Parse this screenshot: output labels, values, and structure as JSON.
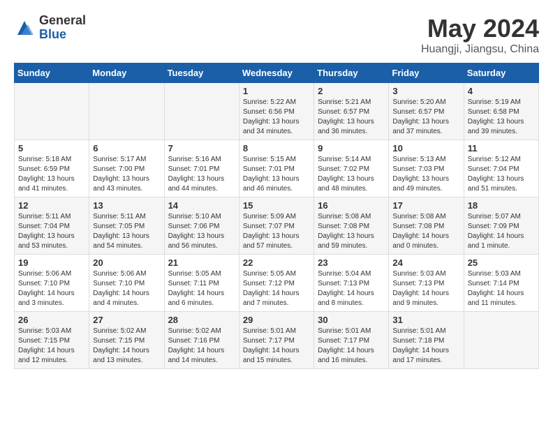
{
  "header": {
    "logo_general": "General",
    "logo_blue": "Blue",
    "title": "May 2024",
    "subtitle": "Huangji, Jiangsu, China"
  },
  "days_of_week": [
    "Sunday",
    "Monday",
    "Tuesday",
    "Wednesday",
    "Thursday",
    "Friday",
    "Saturday"
  ],
  "weeks": [
    [
      {
        "day": "",
        "info": ""
      },
      {
        "day": "",
        "info": ""
      },
      {
        "day": "",
        "info": ""
      },
      {
        "day": "1",
        "info": "Sunrise: 5:22 AM\nSunset: 6:56 PM\nDaylight: 13 hours and 34 minutes."
      },
      {
        "day": "2",
        "info": "Sunrise: 5:21 AM\nSunset: 6:57 PM\nDaylight: 13 hours and 36 minutes."
      },
      {
        "day": "3",
        "info": "Sunrise: 5:20 AM\nSunset: 6:57 PM\nDaylight: 13 hours and 37 minutes."
      },
      {
        "day": "4",
        "info": "Sunrise: 5:19 AM\nSunset: 6:58 PM\nDaylight: 13 hours and 39 minutes."
      }
    ],
    [
      {
        "day": "5",
        "info": "Sunrise: 5:18 AM\nSunset: 6:59 PM\nDaylight: 13 hours and 41 minutes."
      },
      {
        "day": "6",
        "info": "Sunrise: 5:17 AM\nSunset: 7:00 PM\nDaylight: 13 hours and 43 minutes."
      },
      {
        "day": "7",
        "info": "Sunrise: 5:16 AM\nSunset: 7:01 PM\nDaylight: 13 hours and 44 minutes."
      },
      {
        "day": "8",
        "info": "Sunrise: 5:15 AM\nSunset: 7:01 PM\nDaylight: 13 hours and 46 minutes."
      },
      {
        "day": "9",
        "info": "Sunrise: 5:14 AM\nSunset: 7:02 PM\nDaylight: 13 hours and 48 minutes."
      },
      {
        "day": "10",
        "info": "Sunrise: 5:13 AM\nSunset: 7:03 PM\nDaylight: 13 hours and 49 minutes."
      },
      {
        "day": "11",
        "info": "Sunrise: 5:12 AM\nSunset: 7:04 PM\nDaylight: 13 hours and 51 minutes."
      }
    ],
    [
      {
        "day": "12",
        "info": "Sunrise: 5:11 AM\nSunset: 7:04 PM\nDaylight: 13 hours and 53 minutes."
      },
      {
        "day": "13",
        "info": "Sunrise: 5:11 AM\nSunset: 7:05 PM\nDaylight: 13 hours and 54 minutes."
      },
      {
        "day": "14",
        "info": "Sunrise: 5:10 AM\nSunset: 7:06 PM\nDaylight: 13 hours and 56 minutes."
      },
      {
        "day": "15",
        "info": "Sunrise: 5:09 AM\nSunset: 7:07 PM\nDaylight: 13 hours and 57 minutes."
      },
      {
        "day": "16",
        "info": "Sunrise: 5:08 AM\nSunset: 7:08 PM\nDaylight: 13 hours and 59 minutes."
      },
      {
        "day": "17",
        "info": "Sunrise: 5:08 AM\nSunset: 7:08 PM\nDaylight: 14 hours and 0 minutes."
      },
      {
        "day": "18",
        "info": "Sunrise: 5:07 AM\nSunset: 7:09 PM\nDaylight: 14 hours and 1 minute."
      }
    ],
    [
      {
        "day": "19",
        "info": "Sunrise: 5:06 AM\nSunset: 7:10 PM\nDaylight: 14 hours and 3 minutes."
      },
      {
        "day": "20",
        "info": "Sunrise: 5:06 AM\nSunset: 7:10 PM\nDaylight: 14 hours and 4 minutes."
      },
      {
        "day": "21",
        "info": "Sunrise: 5:05 AM\nSunset: 7:11 PM\nDaylight: 14 hours and 6 minutes."
      },
      {
        "day": "22",
        "info": "Sunrise: 5:05 AM\nSunset: 7:12 PM\nDaylight: 14 hours and 7 minutes."
      },
      {
        "day": "23",
        "info": "Sunrise: 5:04 AM\nSunset: 7:13 PM\nDaylight: 14 hours and 8 minutes."
      },
      {
        "day": "24",
        "info": "Sunrise: 5:03 AM\nSunset: 7:13 PM\nDaylight: 14 hours and 9 minutes."
      },
      {
        "day": "25",
        "info": "Sunrise: 5:03 AM\nSunset: 7:14 PM\nDaylight: 14 hours and 11 minutes."
      }
    ],
    [
      {
        "day": "26",
        "info": "Sunrise: 5:03 AM\nSunset: 7:15 PM\nDaylight: 14 hours and 12 minutes."
      },
      {
        "day": "27",
        "info": "Sunrise: 5:02 AM\nSunset: 7:15 PM\nDaylight: 14 hours and 13 minutes."
      },
      {
        "day": "28",
        "info": "Sunrise: 5:02 AM\nSunset: 7:16 PM\nDaylight: 14 hours and 14 minutes."
      },
      {
        "day": "29",
        "info": "Sunrise: 5:01 AM\nSunset: 7:17 PM\nDaylight: 14 hours and 15 minutes."
      },
      {
        "day": "30",
        "info": "Sunrise: 5:01 AM\nSunset: 7:17 PM\nDaylight: 14 hours and 16 minutes."
      },
      {
        "day": "31",
        "info": "Sunrise: 5:01 AM\nSunset: 7:18 PM\nDaylight: 14 hours and 17 minutes."
      },
      {
        "day": "",
        "info": ""
      }
    ]
  ]
}
